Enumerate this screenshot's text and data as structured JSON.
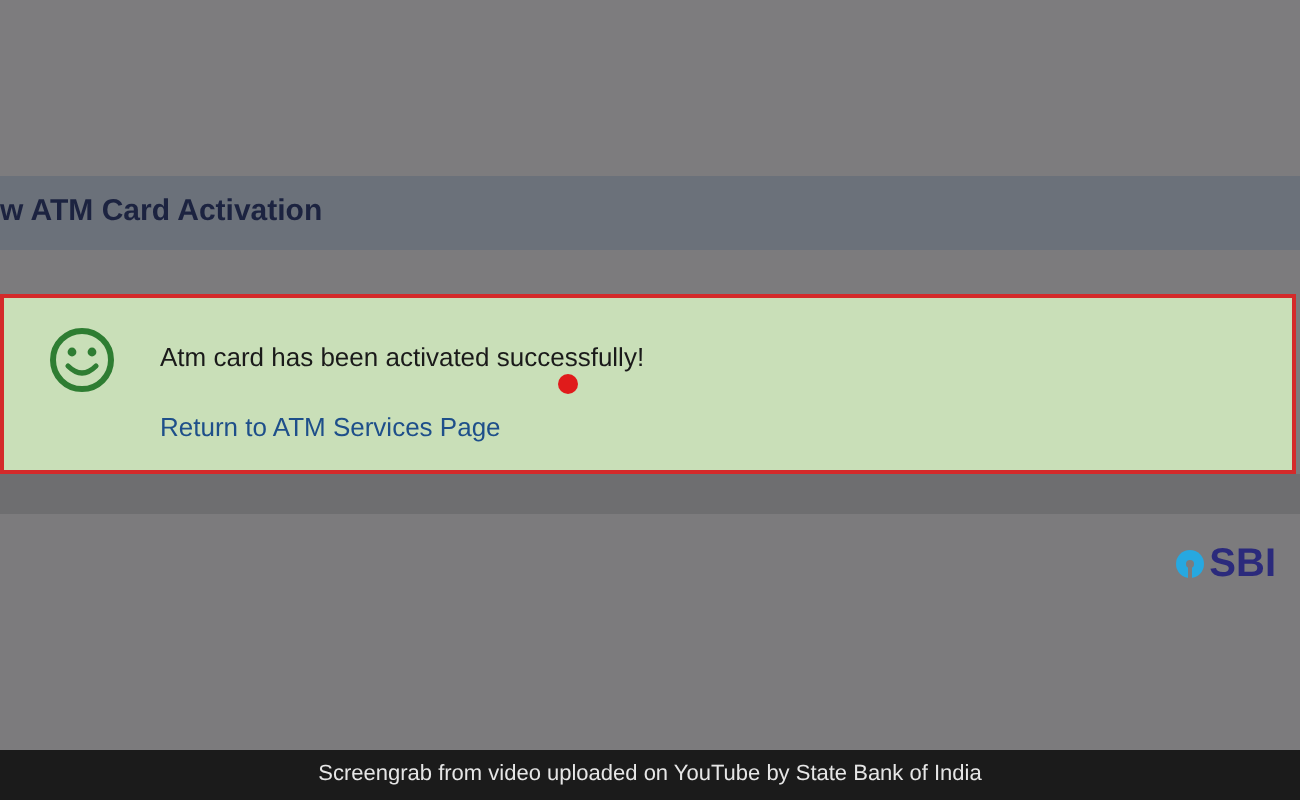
{
  "heading": "w ATM Card Activation",
  "alert": {
    "message": "Atm card has been activated successfully!",
    "link": "Return to ATM Services Page"
  },
  "logo": {
    "text": "SBI"
  },
  "caption": "Screengrab from video uploaded on YouTube by State Bank of India"
}
